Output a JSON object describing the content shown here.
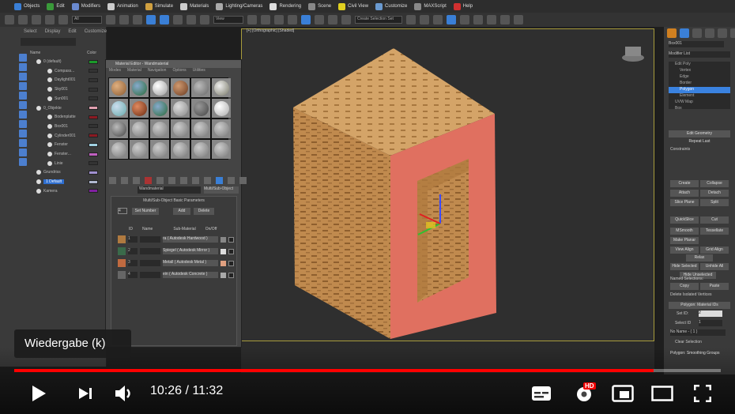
{
  "menubar": {
    "items": [
      "Objects",
      "Edit",
      "Modifiers",
      "Animation",
      "Simulate",
      "Materials",
      "Lighting/Cameras",
      "Rendering",
      "Scene",
      "Civil View",
      "Customize",
      "MAXScript",
      "Help"
    ]
  },
  "toolbar": {
    "selection_filter": "All",
    "ref_coord": "View",
    "named_selection": "Create Selection Set"
  },
  "viewport": {
    "label": "[+] [Orthographic] [Shaded]"
  },
  "explorer": {
    "menu": [
      "Select",
      "Display",
      "Edit",
      "Customize"
    ],
    "col_name": "Name",
    "col_color": "Color",
    "rows": [
      {
        "label": "0 (default)",
        "color": "#1a9a2a"
      },
      {
        "label": "Compass...",
        "color": "#333"
      },
      {
        "label": "Daylight001",
        "color": "#333"
      },
      {
        "label": "Sky001",
        "color": "#333"
      },
      {
        "label": "Sun001",
        "color": "#333"
      },
      {
        "label": "0_Objekte",
        "color": "#e0a0b0"
      },
      {
        "label": "Bodenplatte",
        "color": "#8a1a22"
      },
      {
        "label": "Box001",
        "color": "#333"
      },
      {
        "label": "Cylinder001",
        "color": "#8a1a22"
      },
      {
        "label": "Fenster",
        "color": "#a0d0e0"
      },
      {
        "label": "Fenster...",
        "color": "#c060c0"
      },
      {
        "label": "Linie",
        "color": "#333"
      },
      {
        "label": "Grundriss",
        "color": "#a090d0"
      },
      {
        "label": "1 Default",
        "color": "#b0b8d0"
      },
      {
        "label": "Kamera",
        "color": "#8020a0"
      }
    ]
  },
  "material_editor": {
    "title": "Material Editor - Wandmaterial",
    "menu": [
      "Modes",
      "Material",
      "Navigation",
      "Options",
      "Utilities"
    ],
    "material_name": "Wandmaterial",
    "material_type": "Multi/Sub-Object",
    "rollout": "Multi/Sub-Object Basic Parameters",
    "count": "4",
    "set_number": "Set Number",
    "add": "Add",
    "delete": "Delete",
    "col_id": "ID",
    "col_name": "Name",
    "col_sub": "Sub-Material",
    "col_onoff": "On/Off",
    "rows": [
      {
        "id": "1",
        "sub": "ra ( Autodesk Hardwood )",
        "color": "#888"
      },
      {
        "id": "2",
        "sub": "Spiegel ( Autodesk Mirror )",
        "color": "#ddd"
      },
      {
        "id": "3",
        "sub": "Metall ( Autodesk Metal )",
        "color": "#e0a080"
      },
      {
        "id": "4",
        "sub": "ein ( Autodesk Concrete )",
        "color": "#aaa"
      }
    ]
  },
  "command_panel": {
    "object_name": "Box001",
    "modifier_list": "Modifier List",
    "stack": [
      "Edit Poly",
      "Vertex",
      "Edge",
      "Border",
      "Polygon",
      "Element",
      "UVW Map",
      "Box"
    ],
    "selected_stack": "Polygon",
    "edit_geometry": "Edit Geometry",
    "repeat_last": "Repeat Last",
    "constraints": "Constraints",
    "buttons": [
      "Create",
      "Collapse",
      "Attach",
      "Detach",
      "Slice Plane",
      "Split",
      "QuickSlice",
      "Cut",
      "MSmooth",
      "Tessellate",
      "Make Planar",
      "View Align",
      "Grid Align",
      "Relax",
      "Hide Selected",
      "Unhide All",
      "Hide Unselected"
    ],
    "named_selections": "Named Selections:",
    "copy": "Copy",
    "paste": "Paste",
    "delete_isolated": "Delete Isolated Vertices",
    "material_ids": "Polygon: Material IDs",
    "set_id_label": "Set ID:",
    "set_id": "2",
    "select_id_label": "Select ID",
    "select_id": "1",
    "no_name": "No Name - ( 1 )",
    "clear_selection": "Clear Selection",
    "smoothing": "Polygon: Smoothing Groups"
  },
  "player": {
    "tooltip": "Wiedergabe (k)",
    "current_time": "10:26",
    "duration": "11:32",
    "time_display": "10:26 / 11:32",
    "progress": 0.905,
    "accent": "#ff0000",
    "hd_badge": "HD"
  }
}
